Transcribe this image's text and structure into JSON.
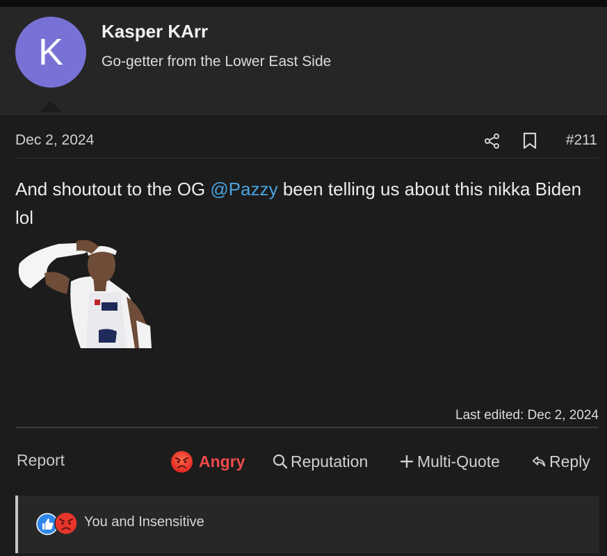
{
  "user": {
    "avatar_letter": "K",
    "avatar_color": "#7872d6",
    "name": "Kasper KArr",
    "title": "Go-getter from the Lower East Side"
  },
  "post": {
    "date": "Dec 2, 2024",
    "number": "#211",
    "message_before": "And shoutout to the OG ",
    "mention": "@Pazzy",
    "message_after": " been telling us about this nikka Biden lol",
    "last_edited": "Last edited: Dec 2, 2024"
  },
  "actions": {
    "report": "Report",
    "angry": "Angry",
    "reputation": "Reputation",
    "multi_quote": "Multi-Quote",
    "reply": "Reply"
  },
  "reactions": {
    "text": "You and Insensitive"
  },
  "icons": [
    "share-icon",
    "bookmark-icon",
    "angry-face-icon",
    "search-icon",
    "plus-icon",
    "reply-icon",
    "like-icon"
  ],
  "colors": {
    "mention": "#4aa3df",
    "angry": "#f04a4a",
    "avatar": "#7872d6"
  }
}
